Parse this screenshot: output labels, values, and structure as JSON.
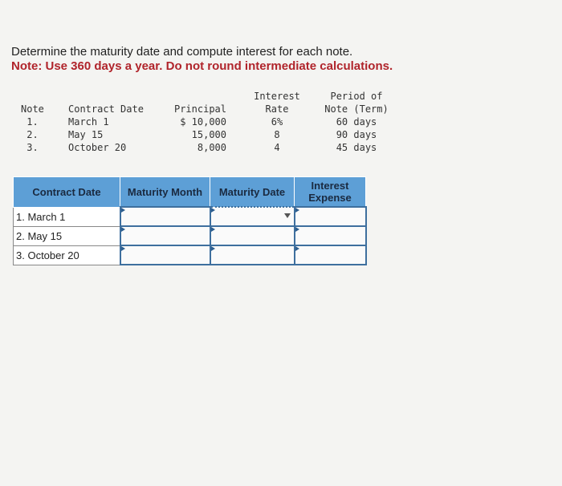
{
  "question": {
    "text": "Determine the maturity date and compute interest for each note.",
    "note": "Note: Use 360 days a year. Do not round intermediate calculations."
  },
  "given": {
    "headers": {
      "note": "Note",
      "contract_date": "Contract Date",
      "principal": "Principal",
      "rate_1": "Interest",
      "rate_2": "Rate",
      "period_1": "Period of",
      "period_2": "Note (Term)"
    },
    "rows": [
      {
        "note": "1.",
        "date": "March 1",
        "principal": "$ 10,000",
        "rate": "6%",
        "period": "60 days"
      },
      {
        "note": "2.",
        "date": "May 15",
        "principal": "15,000",
        "rate": "8",
        "period": "90 days"
      },
      {
        "note": "3.",
        "date": "October 20",
        "principal": "8,000",
        "rate": "4",
        "period": "45 days"
      }
    ]
  },
  "answer": {
    "headers": [
      "Contract Date",
      "Maturity Month",
      "Maturity Date",
      "Interest Expense"
    ],
    "rows": [
      {
        "label": "1. March 1"
      },
      {
        "label": "2. May 15"
      },
      {
        "label": "3. October 20"
      }
    ]
  }
}
